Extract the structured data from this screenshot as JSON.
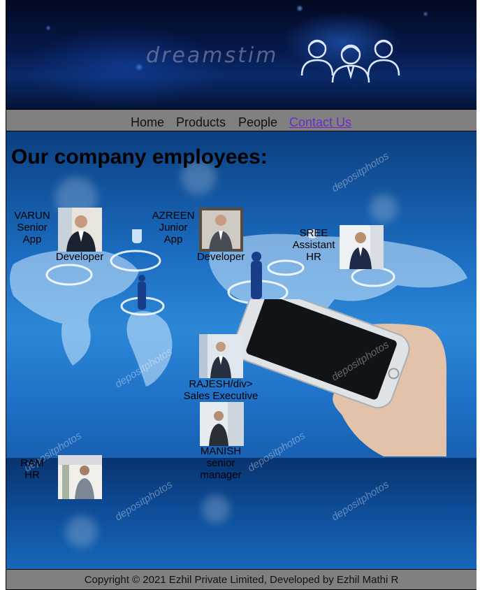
{
  "header": {
    "logo_text": "dreamstim",
    "logo_icon": "people-group-icon"
  },
  "nav": {
    "items": [
      "Home",
      "Products",
      "People",
      "Contact Us"
    ]
  },
  "main": {
    "heading": "Our company employees:",
    "employees": [
      {
        "name": "VARUN",
        "title": "Senior App Developer",
        "lines": [
          "VARUN",
          "Senior",
          "App"
        ],
        "tail": "Developer"
      },
      {
        "name": "AZREEN",
        "title": "Junior App Developer",
        "lines": [
          "AZREEN",
          "Junior",
          "App"
        ],
        "tail": "Developer"
      },
      {
        "name": "SREE",
        "title": "Assistant HR",
        "lines": [
          "SREE",
          "Assistant",
          "HR"
        ]
      },
      {
        "name": "RAJESH",
        "lines": [
          "RAJESH/div>",
          "Sales Executive"
        ]
      },
      {
        "name": "MANISH",
        "lines": [
          "MANISH",
          "senior",
          "manager"
        ]
      },
      {
        "name": "RAM",
        "lines": [
          "RAM",
          "HR"
        ]
      }
    ],
    "watermark_text": "depositphotos"
  },
  "footer": {
    "copyright": "Copyright © 2021 Ezhil Private Limited, Developed by Ezhil Mathi R"
  },
  "colors": {
    "nav_bg": "#808080",
    "visited_link": "#6b2bc6",
    "banner_dark": "#06184a",
    "content_blue": "#2c87d7"
  }
}
